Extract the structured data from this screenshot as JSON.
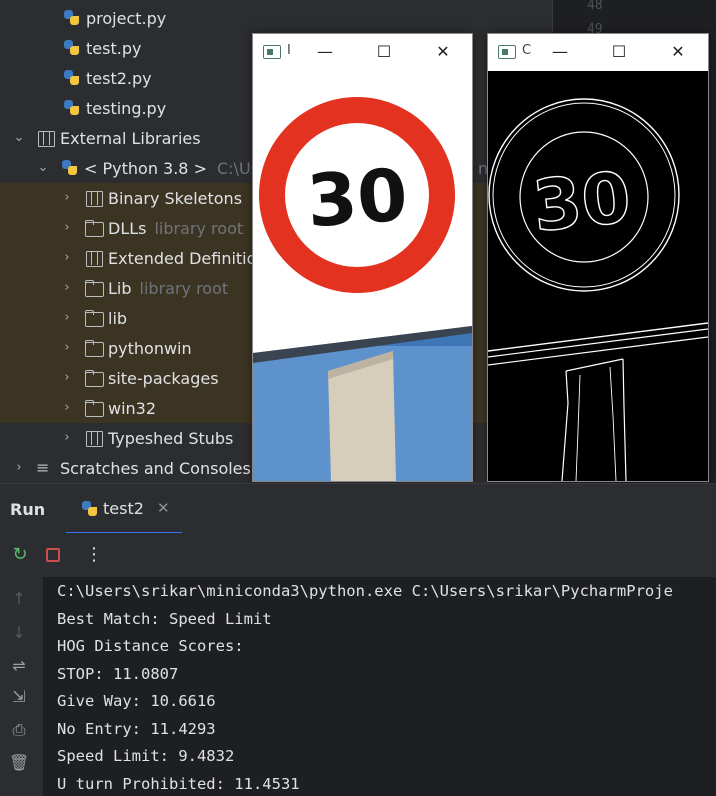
{
  "project_tree": {
    "files": [
      {
        "name": "project.py"
      },
      {
        "name": "test.py"
      },
      {
        "name": "test2.py"
      },
      {
        "name": "testing.py"
      }
    ],
    "external_libraries_label": "External Libraries",
    "python_sdk": {
      "label": "< Python 3.8 >",
      "path": "C:\\Us"
    },
    "python_sdk_path_tail": "n.e",
    "children": [
      {
        "label": "Binary Skeletons",
        "note": "",
        "icon": "libs-icon"
      },
      {
        "label": "DLLs",
        "note": "library root",
        "icon": "folder-icon"
      },
      {
        "label": "Extended Definitio",
        "note": "",
        "icon": "libs-icon"
      },
      {
        "label": "Lib",
        "note": "library root",
        "icon": "folder-icon"
      },
      {
        "label": "lib",
        "note": "",
        "icon": "folder-icon"
      },
      {
        "label": "pythonwin",
        "note": "",
        "icon": "folder-icon"
      },
      {
        "label": "site-packages",
        "note": "",
        "icon": "folder-icon"
      },
      {
        "label": "win32",
        "note": "",
        "icon": "folder-icon"
      }
    ],
    "typeshed_label": "Typeshed Stubs",
    "scratches_label": "Scratches and Consoles"
  },
  "editor": {
    "line_numbers": [
      "48",
      "49"
    ]
  },
  "windows": [
    {
      "title": "I",
      "content": "original-image"
    },
    {
      "title": "C",
      "content": "edge-image"
    }
  ],
  "sign": {
    "speed": "30"
  },
  "run_panel": {
    "title": "Run",
    "tab_label": "test2",
    "console_lines": [
      "C:\\Users\\srikar\\miniconda3\\python.exe C:\\Users\\srikar\\PycharmProje",
      "Best Match: Speed Limit",
      "HOG Distance Scores:",
      "STOP: 11.0807",
      "Give Way: 10.6616",
      "No Entry: 11.4293",
      "Speed Limit: 9.4832",
      "U turn Prohibited: 11.4531"
    ]
  },
  "colors": {
    "accent": "#3574f0",
    "stop_button": "#c94f4f",
    "rerun_button": "#5fb865",
    "library_row": "#3c3423"
  }
}
